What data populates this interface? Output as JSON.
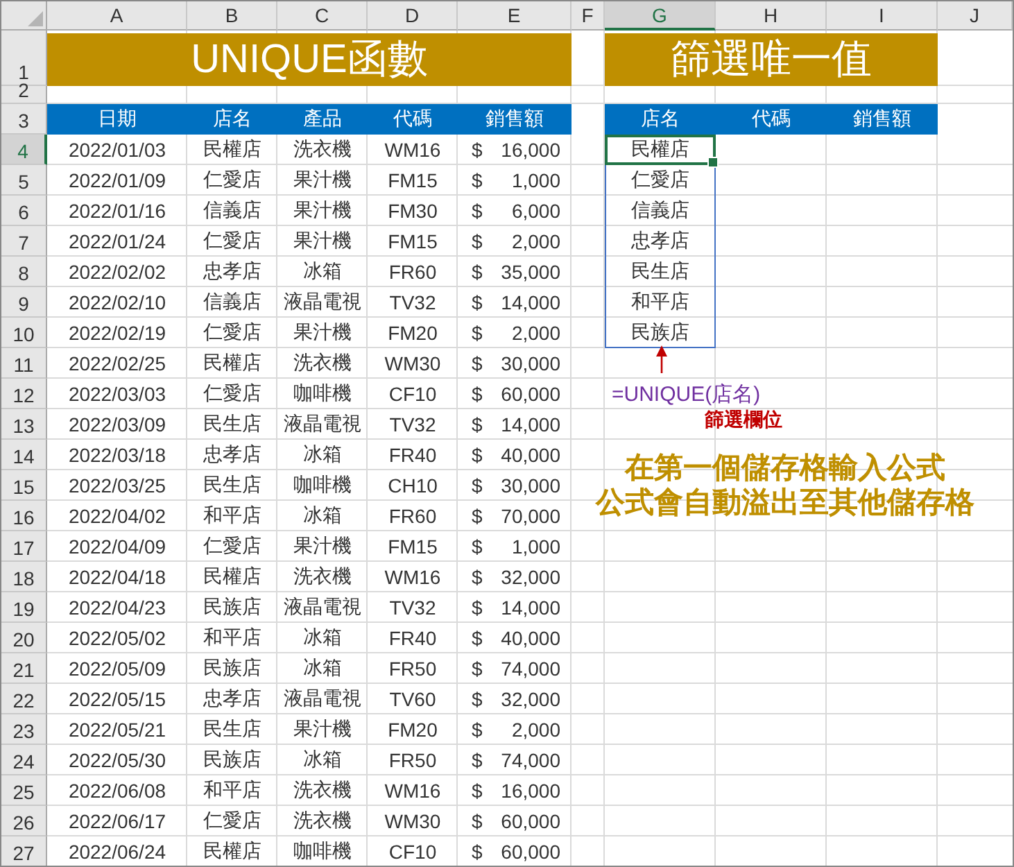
{
  "column_headers": [
    {
      "label": "A",
      "selected": false
    },
    {
      "label": "B",
      "selected": false
    },
    {
      "label": "C",
      "selected": false
    },
    {
      "label": "D",
      "selected": false
    },
    {
      "label": "E",
      "selected": false
    },
    {
      "label": "F",
      "selected": false
    },
    {
      "label": "G",
      "selected": true
    },
    {
      "label": "H",
      "selected": false
    },
    {
      "label": "I",
      "selected": false
    },
    {
      "label": "J",
      "selected": false
    }
  ],
  "row_headers": [
    {
      "label": "1",
      "selected": false
    },
    {
      "label": "2",
      "selected": false
    },
    {
      "label": "3",
      "selected": false
    },
    {
      "label": "4",
      "selected": true
    },
    {
      "label": "5",
      "selected": false
    },
    {
      "label": "6",
      "selected": false
    },
    {
      "label": "7",
      "selected": false
    },
    {
      "label": "8",
      "selected": false
    },
    {
      "label": "9",
      "selected": false
    },
    {
      "label": "10",
      "selected": false
    },
    {
      "label": "11",
      "selected": false
    },
    {
      "label": "12",
      "selected": false
    },
    {
      "label": "13",
      "selected": false
    },
    {
      "label": "14",
      "selected": false
    },
    {
      "label": "15",
      "selected": false
    },
    {
      "label": "16",
      "selected": false
    },
    {
      "label": "17",
      "selected": false
    },
    {
      "label": "18",
      "selected": false
    },
    {
      "label": "19",
      "selected": false
    },
    {
      "label": "20",
      "selected": false
    },
    {
      "label": "21",
      "selected": false
    },
    {
      "label": "22",
      "selected": false
    },
    {
      "label": "23",
      "selected": false
    },
    {
      "label": "24",
      "selected": false
    },
    {
      "label": "25",
      "selected": false
    },
    {
      "label": "26",
      "selected": false
    },
    {
      "label": "27",
      "selected": false
    }
  ],
  "left_title": "UNIQUE函數",
  "right_title": "篩選唯一值",
  "table": {
    "columns": [
      "日期",
      "店名",
      "產品",
      "代碼",
      "銷售額"
    ],
    "rows": [
      {
        "date": "2022/01/03",
        "store": "民權店",
        "product": "洗衣機",
        "code": "WM16",
        "currency": "$",
        "amount": "16,000"
      },
      {
        "date": "2022/01/09",
        "store": "仁愛店",
        "product": "果汁機",
        "code": "FM15",
        "currency": "$",
        "amount": "1,000"
      },
      {
        "date": "2022/01/16",
        "store": "信義店",
        "product": "果汁機",
        "code": "FM30",
        "currency": "$",
        "amount": "6,000"
      },
      {
        "date": "2022/01/24",
        "store": "仁愛店",
        "product": "果汁機",
        "code": "FM15",
        "currency": "$",
        "amount": "2,000"
      },
      {
        "date": "2022/02/02",
        "store": "忠孝店",
        "product": "冰箱",
        "code": "FR60",
        "currency": "$",
        "amount": "35,000"
      },
      {
        "date": "2022/02/10",
        "store": "信義店",
        "product": "液晶電視",
        "code": "TV32",
        "currency": "$",
        "amount": "14,000"
      },
      {
        "date": "2022/02/19",
        "store": "仁愛店",
        "product": "果汁機",
        "code": "FM20",
        "currency": "$",
        "amount": "2,000"
      },
      {
        "date": "2022/02/25",
        "store": "民權店",
        "product": "洗衣機",
        "code": "WM30",
        "currency": "$",
        "amount": "30,000"
      },
      {
        "date": "2022/03/03",
        "store": "仁愛店",
        "product": "咖啡機",
        "code": "CF10",
        "currency": "$",
        "amount": "60,000"
      },
      {
        "date": "2022/03/09",
        "store": "民生店",
        "product": "液晶電視",
        "code": "TV32",
        "currency": "$",
        "amount": "14,000"
      },
      {
        "date": "2022/03/18",
        "store": "忠孝店",
        "product": "冰箱",
        "code": "FR40",
        "currency": "$",
        "amount": "40,000"
      },
      {
        "date": "2022/03/25",
        "store": "民生店",
        "product": "咖啡機",
        "code": "CH10",
        "currency": "$",
        "amount": "30,000"
      },
      {
        "date": "2022/04/02",
        "store": "和平店",
        "product": "冰箱",
        "code": "FR60",
        "currency": "$",
        "amount": "70,000"
      },
      {
        "date": "2022/04/09",
        "store": "仁愛店",
        "product": "果汁機",
        "code": "FM15",
        "currency": "$",
        "amount": "1,000"
      },
      {
        "date": "2022/04/18",
        "store": "民權店",
        "product": "洗衣機",
        "code": "WM16",
        "currency": "$",
        "amount": "32,000"
      },
      {
        "date": "2022/04/23",
        "store": "民族店",
        "product": "液晶電視",
        "code": "TV32",
        "currency": "$",
        "amount": "14,000"
      },
      {
        "date": "2022/05/02",
        "store": "和平店",
        "product": "冰箱",
        "code": "FR40",
        "currency": "$",
        "amount": "40,000"
      },
      {
        "date": "2022/05/09",
        "store": "民族店",
        "product": "冰箱",
        "code": "FR50",
        "currency": "$",
        "amount": "74,000"
      },
      {
        "date": "2022/05/15",
        "store": "忠孝店",
        "product": "液晶電視",
        "code": "TV60",
        "currency": "$",
        "amount": "32,000"
      },
      {
        "date": "2022/05/21",
        "store": "民生店",
        "product": "果汁機",
        "code": "FM20",
        "currency": "$",
        "amount": "2,000"
      },
      {
        "date": "2022/05/30",
        "store": "民族店",
        "product": "冰箱",
        "code": "FR50",
        "currency": "$",
        "amount": "74,000"
      },
      {
        "date": "2022/06/08",
        "store": "和平店",
        "product": "洗衣機",
        "code": "WM16",
        "currency": "$",
        "amount": "16,000"
      },
      {
        "date": "2022/06/17",
        "store": "仁愛店",
        "product": "洗衣機",
        "code": "WM30",
        "currency": "$",
        "amount": "60,000"
      },
      {
        "date": "2022/06/24",
        "store": "民權店",
        "product": "咖啡機",
        "code": "CF10",
        "currency": "$",
        "amount": "60,000"
      }
    ]
  },
  "result": {
    "columns": [
      "店名",
      "代碼",
      "銷售額"
    ],
    "values": [
      {
        "text": "民權店",
        "selected": true
      },
      {
        "text": "仁愛店",
        "selected": false
      },
      {
        "text": "信義店",
        "selected": false
      },
      {
        "text": "忠孝店",
        "selected": false
      },
      {
        "text": "民生店",
        "selected": false
      },
      {
        "text": "和平店",
        "selected": false
      },
      {
        "text": "民族店",
        "selected": false
      }
    ]
  },
  "annotations": {
    "formula": "=UNIQUE(店名)",
    "field_label": "篩選欄位",
    "note_lines": [
      "在第一個儲存格輸入公式",
      "公式會自動溢出至其他儲存格"
    ]
  }
}
